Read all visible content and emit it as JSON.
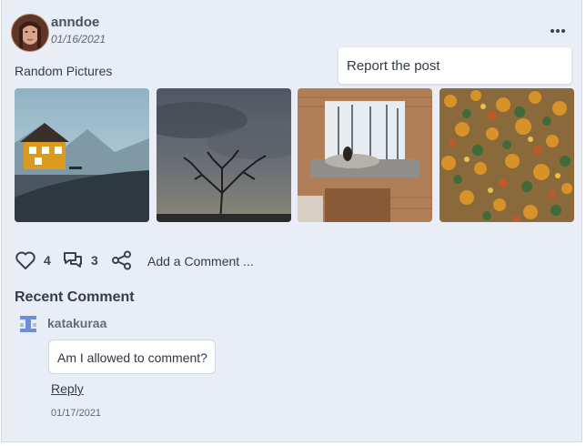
{
  "post": {
    "username": "anndoe",
    "date": "01/16/2021",
    "more_label": "•••",
    "menu": {
      "report_label": "Report the post"
    },
    "text": "Random Pictures",
    "photos": [
      {
        "icon": "yellow-cabin-photo"
      },
      {
        "icon": "stormy-sky-tree-photo"
      },
      {
        "icon": "cabin-window-photo"
      },
      {
        "icon": "autumn-forest-photo"
      }
    ]
  },
  "actions": {
    "likes": "4",
    "comments": "3",
    "add_comment_label": "Add a Comment ..."
  },
  "recent": {
    "title": "Recent Comment",
    "comment": {
      "username": "katakuraa",
      "text": "Am I allowed to comment?",
      "reply_label": "Reply",
      "date": "01/17/2021"
    }
  },
  "colors": {
    "card_bg": "#e9edf5",
    "accent_icon": "#3b4150",
    "comment_avatar": "#6d8fd9"
  }
}
